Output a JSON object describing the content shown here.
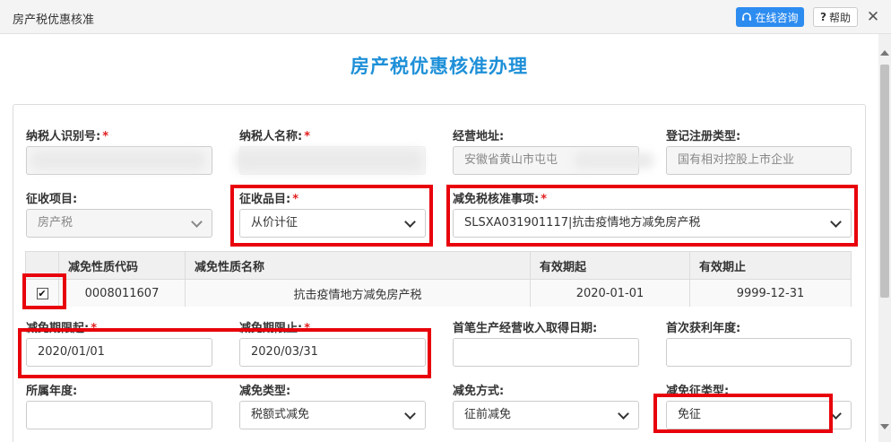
{
  "window": {
    "title": "房产税优惠核准",
    "consult_label": "在线咨询",
    "help_label": "帮助",
    "close_glyph": "✕"
  },
  "page_heading": "房产税优惠核准办理",
  "colors": {
    "accent": "#1e90d8",
    "button": "#2d8cf0",
    "highlight": "#e8000b",
    "required": "#e02020"
  },
  "required_mark": "*",
  "fields": {
    "taxpayer_id": {
      "label": "纳税人识别号:",
      "required": true
    },
    "taxpayer_name": {
      "label": "纳税人名称:",
      "required": true
    },
    "business_address": {
      "label": "经营地址:",
      "value": "安徽省黄山市屯屯"
    },
    "registration_type": {
      "label": "登记注册类型:",
      "value": "国有相对控股上市企业"
    },
    "collection_item": {
      "label": "征收项目:",
      "value": "房产税"
    },
    "collection_subitem": {
      "label": "征收品目:",
      "required": true,
      "value": "从价计征"
    },
    "relief_item": {
      "label": "减免税核准事项:",
      "required": true,
      "value": "SLSXA031901117|抗击疫情地方减免房产税"
    },
    "relief_start": {
      "label": "减免期限起:",
      "required": true,
      "value": "2020/01/01"
    },
    "relief_end": {
      "label": "减免期限止:",
      "required": true,
      "value": "2020/03/31"
    },
    "first_income_date": {
      "label": "首笔生产经营收入取得日期:",
      "value": ""
    },
    "first_profit_year": {
      "label": "首次获利年度:",
      "value": ""
    },
    "belong_year": {
      "label": "所属年度:",
      "value": ""
    },
    "relief_type": {
      "label": "减免类型:",
      "value": "税额式减免"
    },
    "relief_method": {
      "label": "减免方式:",
      "value": "征前减免"
    },
    "relief_collect_type": {
      "label": "减免征类型:",
      "value": "免征"
    }
  },
  "relief_table": {
    "headers": [
      "减免性质代码",
      "减免性质名称",
      "有效期起",
      "有效期止"
    ],
    "rows": [
      {
        "checked": true,
        "check_glyph": "✔",
        "code": "0008011607",
        "name": "抗击疫情地方减免房产税",
        "start": "2020-01-01",
        "end": "9999-12-31"
      }
    ]
  },
  "icons": {
    "consult": "headset-icon",
    "help": "question-icon",
    "close": "close-icon",
    "dropdown": "chevron-down-icon"
  }
}
